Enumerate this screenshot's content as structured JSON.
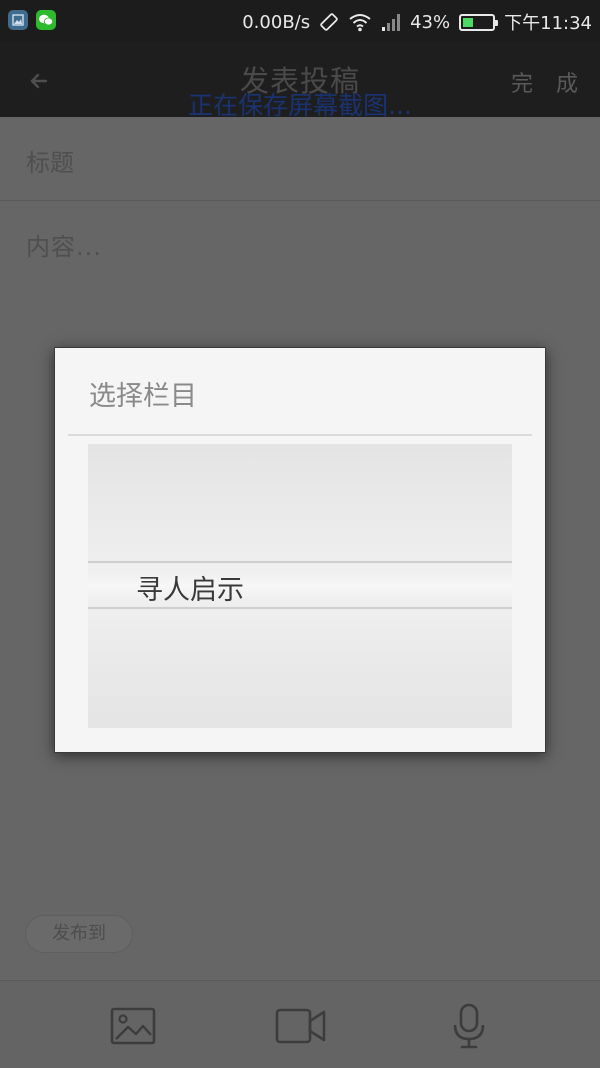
{
  "status_bar": {
    "speed": "0.00B/s",
    "battery_percent": "43%",
    "battery_level": 0.43,
    "time": "下午11:34"
  },
  "header": {
    "title": "发表投稿",
    "done_label": "完 成",
    "toast": "正在保存屏幕截图..."
  },
  "form": {
    "title_placeholder": "标题",
    "content_placeholder": "内容...",
    "publish_to_label": "发布到"
  },
  "dialog": {
    "title": "选择栏目",
    "selected_item": "寻人启示"
  },
  "toolbar": {
    "icons": [
      "image-icon",
      "video-icon",
      "mic-icon"
    ]
  },
  "colors": {
    "status_bar_bg": "#1c1c1c",
    "dim_overlay": "#666666",
    "dialog_bg": "#f5f5f5",
    "toast_text": "#1a3370"
  }
}
